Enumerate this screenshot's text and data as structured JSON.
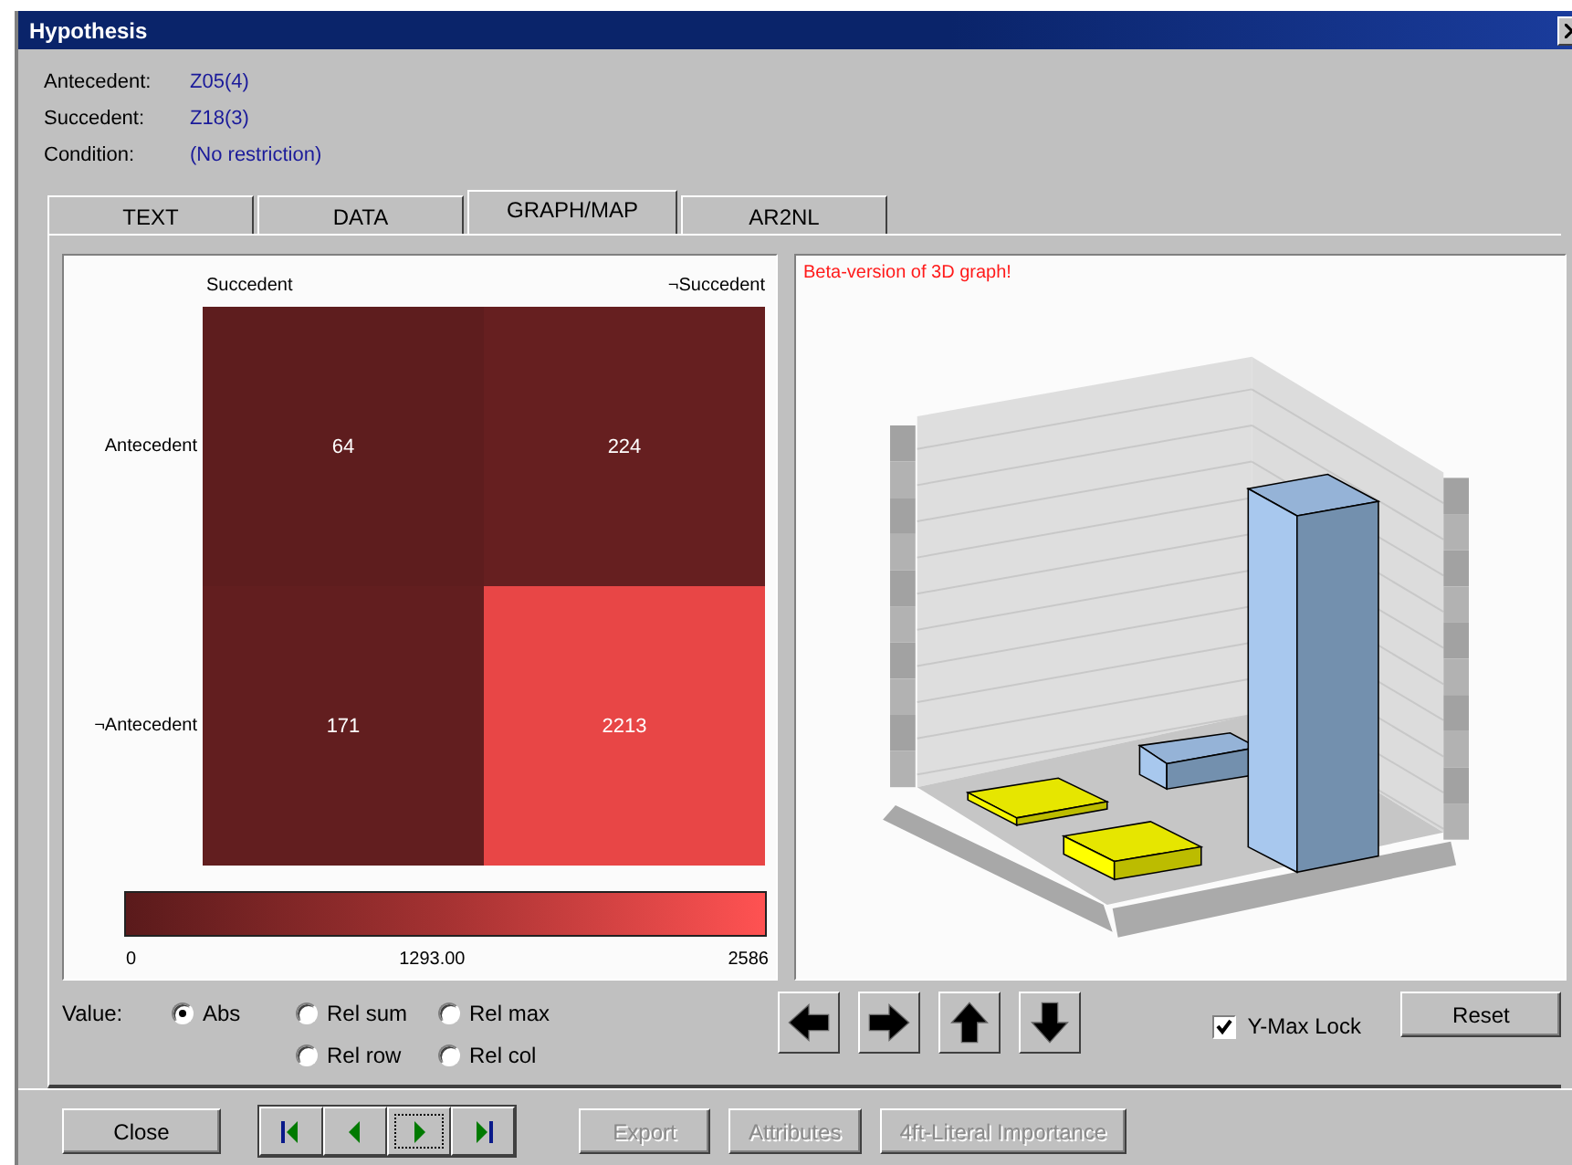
{
  "window": {
    "title": "Hypothesis"
  },
  "info": [
    {
      "label": "Antecedent:",
      "value": "Z05(4)"
    },
    {
      "label": "Succedent:",
      "value": "Z18(3)"
    },
    {
      "label": "Condition:",
      "value": "(No restriction)"
    }
  ],
  "tabs": [
    {
      "label": "TEXT",
      "selected": false
    },
    {
      "label": "DATA",
      "selected": false
    },
    {
      "label": "GRAPH/MAP",
      "selected": true
    },
    {
      "label": "AR2NL",
      "selected": false
    }
  ],
  "heatmap": {
    "columns": [
      "Succedent",
      "¬Succedent"
    ],
    "rows": [
      {
        "label": "Antecedent",
        "cells": [
          {
            "value": "64",
            "color": "#5e1d1e"
          },
          {
            "value": "224",
            "color": "#661f20"
          }
        ]
      },
      {
        "label": "¬Antecedent",
        "cells": [
          {
            "value": "171",
            "color": "#621e1f"
          },
          {
            "value": "2213",
            "color": "#e84646"
          }
        ]
      }
    ],
    "scale": [
      "0",
      "1293.00",
      "2586"
    ]
  },
  "graph": {
    "note": "Beta-version of 3D graph!"
  },
  "value_options": {
    "label": "Value:",
    "options": [
      {
        "label": "Abs",
        "selected": true
      },
      {
        "label": "Rel sum",
        "selected": false
      },
      {
        "label": "Rel max",
        "selected": false
      },
      {
        "label": "Rel row",
        "selected": false
      },
      {
        "label": "Rel col",
        "selected": false
      }
    ]
  },
  "rotate_buttons": [
    {
      "kind": "left"
    },
    {
      "kind": "right"
    },
    {
      "kind": "up"
    },
    {
      "kind": "down"
    }
  ],
  "ymax_lock": {
    "label": "Y-Max Lock",
    "checked": true
  },
  "reset": "Reset",
  "close": "Close",
  "nav_buttons": [
    {
      "kind": "first",
      "focused": false
    },
    {
      "kind": "prev",
      "focused": false
    },
    {
      "kind": "next",
      "focused": true
    },
    {
      "kind": "last",
      "focused": false
    }
  ],
  "actions": [
    {
      "label": "Export",
      "disabled": true
    },
    {
      "label": "Attributes",
      "disabled": true
    },
    {
      "label": "4ft-Literal Importance",
      "disabled": true
    }
  ]
}
